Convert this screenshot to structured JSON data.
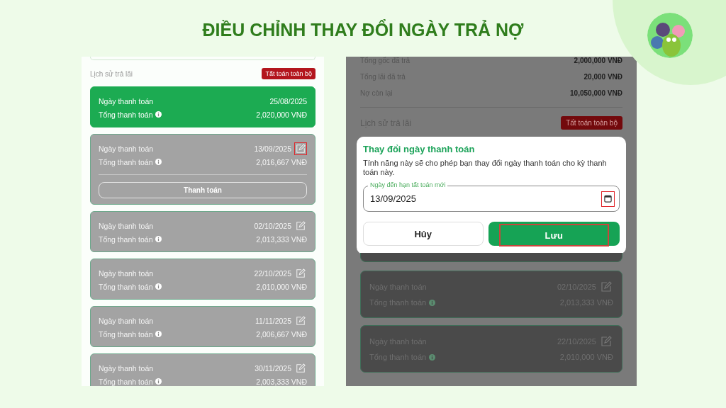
{
  "title": "ĐIỀU CHỈNH THAY ĐỔI NGÀY TRẢ NỢ",
  "left_screen": {
    "history_label": "Lịch sử trả lãi",
    "settle_all_button": "Tất toán toàn bộ",
    "payments": [
      {
        "kind": "paid",
        "date_label": "Ngày thanh toán",
        "date": "25/08/2025",
        "total_label": "Tổng thanh toán",
        "amount": "2,020,000 VNĐ"
      },
      {
        "kind": "due",
        "date_label": "Ngày thanh toán",
        "date": "13/09/2025",
        "total_label": "Tổng thanh toán",
        "amount": "2,016,667 VNĐ",
        "edit_highlighted": true,
        "pay_button": "Thanh toán"
      },
      {
        "kind": "upcoming",
        "date_label": "Ngày thanh toán",
        "date": "02/10/2025",
        "total_label": "Tổng thanh toán",
        "amount": "2,013,333 VNĐ",
        "edit_highlighted": false
      },
      {
        "kind": "upcoming",
        "date_label": "Ngày thanh toán",
        "date": "22/10/2025",
        "total_label": "Tổng thanh toán",
        "amount": "2,010,000 VNĐ",
        "edit_highlighted": false
      },
      {
        "kind": "upcoming",
        "date_label": "Ngày thanh toán",
        "date": "11/11/2025",
        "total_label": "Tổng thanh toán",
        "amount": "2,006,667 VNĐ",
        "edit_highlighted": false
      },
      {
        "kind": "upcoming",
        "date_label": "Ngày thanh toán",
        "date": "30/11/2025",
        "total_label": "Tổng thanh toán",
        "amount": "2,003,333 VNĐ",
        "edit_highlighted": false
      }
    ]
  },
  "right_screen": {
    "summary": [
      {
        "label": "Tổng gốc đã trả",
        "value": "2,000,000 VNĐ"
      },
      {
        "label": "Tổng lãi đã trả",
        "value": "20,000 VNĐ"
      },
      {
        "label": "Nợ còn lại",
        "value": "10,050,000 VNĐ"
      }
    ],
    "history_label": "Lịch sử trả lãi",
    "settle_all_button": "Tất toán toàn bộ",
    "dialog": {
      "title": "Thay đổi ngày thanh toán",
      "description": "Tính năng này sẽ cho phép bạn thay đổi ngày thanh toán cho kỳ thanh toán này.",
      "field_label": "Ngày đến hạn tất toán mới",
      "field_value": "13/09/2025",
      "calendar_highlighted": true,
      "cancel_button": "Hủy",
      "save_button": "Lưu",
      "save_highlighted": true
    },
    "payments": [
      {
        "kind": "upcoming",
        "date_label": "Ngày thanh toán",
        "date": "02/10/2025",
        "total_label": "Tổng thanh toán",
        "amount": "2,013,333 VNĐ",
        "edit_highlighted": false
      },
      {
        "kind": "upcoming",
        "date_label": "Ngày thanh toán",
        "date": "22/10/2025",
        "total_label": "Tổng thanh toán",
        "amount": "2,010,000 VNĐ",
        "edit_highlighted": false
      }
    ]
  }
}
